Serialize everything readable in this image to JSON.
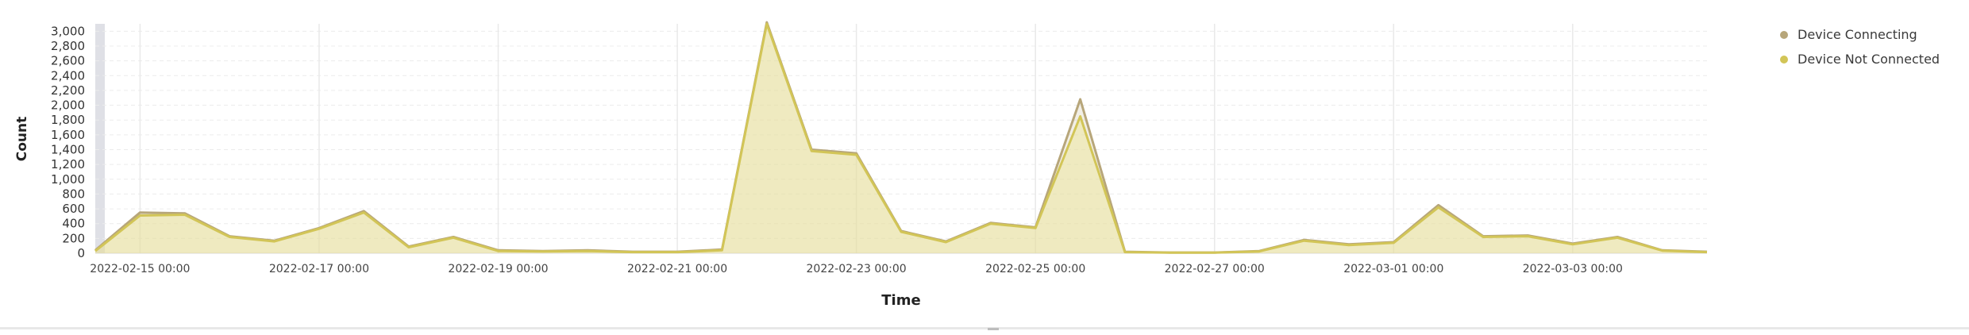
{
  "chart_data": {
    "type": "area",
    "xlabel": "Time",
    "ylabel": "Count",
    "ylim": [
      0,
      3100
    ],
    "y_ticks": [
      0,
      200,
      400,
      600,
      800,
      1000,
      1200,
      1400,
      1600,
      1800,
      2000,
      2200,
      2400,
      2600,
      2800,
      3000
    ],
    "y_tick_labels": [
      "0",
      "200",
      "400",
      "600",
      "800",
      "1,000",
      "1,200",
      "1,400",
      "1,600",
      "1,800",
      "2,000",
      "2,200",
      "2,400",
      "2,600",
      "2,800",
      "3,000"
    ],
    "x_tick_labels": [
      "2022-02-15 00:00",
      "2022-02-17 00:00",
      "2022-02-19 00:00",
      "2022-02-21 00:00",
      "2022-02-23 00:00",
      "2022-02-25 00:00",
      "2022-02-27 00:00",
      "2022-03-01 00:00",
      "2022-03-03 00:00"
    ],
    "x": [
      "2022-02-14 12:00",
      "2022-02-15 00:00",
      "2022-02-15 12:00",
      "2022-02-16 00:00",
      "2022-02-16 12:00",
      "2022-02-17 00:00",
      "2022-02-17 12:00",
      "2022-02-18 00:00",
      "2022-02-18 12:00",
      "2022-02-19 00:00",
      "2022-02-19 12:00",
      "2022-02-20 00:00",
      "2022-02-20 12:00",
      "2022-02-21 00:00",
      "2022-02-21 12:00",
      "2022-02-22 00:00",
      "2022-02-22 12:00",
      "2022-02-23 00:00",
      "2022-02-23 12:00",
      "2022-02-24 00:00",
      "2022-02-24 12:00",
      "2022-02-25 00:00",
      "2022-02-25 12:00",
      "2022-02-26 00:00",
      "2022-02-26 12:00",
      "2022-02-27 00:00",
      "2022-02-27 12:00",
      "2022-02-28 00:00",
      "2022-02-28 12:00",
      "2022-03-01 00:00",
      "2022-03-01 12:00",
      "2022-03-02 00:00",
      "2022-03-02 12:00",
      "2022-03-03 00:00",
      "2022-03-03 12:00",
      "2022-03-04 00:00",
      "2022-03-04 12:00"
    ],
    "series": [
      {
        "name": "Device Connecting",
        "color": "#b7a67a",
        "values": [
          40,
          550,
          540,
          230,
          170,
          340,
          570,
          90,
          220,
          40,
          30,
          40,
          20,
          20,
          50,
          3120,
          1400,
          1350,
          300,
          160,
          410,
          350,
          2080,
          20,
          10,
          10,
          30,
          180,
          120,
          150,
          650,
          230,
          240,
          130,
          220,
          40,
          20
        ]
      },
      {
        "name": "Device Not Connected",
        "color": "#d2c557",
        "values": [
          30,
          510,
          520,
          220,
          160,
          330,
          550,
          80,
          210,
          30,
          25,
          30,
          15,
          15,
          40,
          3100,
          1380,
          1330,
          290,
          150,
          400,
          340,
          1850,
          15,
          8,
          8,
          25,
          170,
          110,
          140,
          620,
          220,
          230,
          120,
          210,
          35,
          15
        ]
      }
    ],
    "grid": true,
    "legend_position": "top-right"
  }
}
